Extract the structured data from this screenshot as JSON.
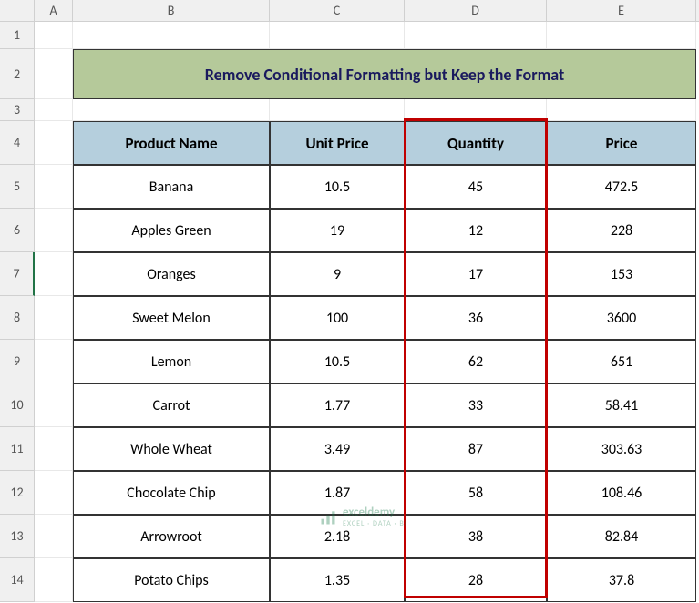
{
  "columns": [
    "A",
    "B",
    "C",
    "D",
    "E"
  ],
  "row_numbers": [
    1,
    2,
    3,
    4,
    5,
    6,
    7,
    8,
    9,
    10,
    11,
    12,
    13,
    14
  ],
  "title": "Remove Conditional Formatting but Keep the Format",
  "headers": {
    "product": "Product Name",
    "unit_price": "Unit Price",
    "quantity": "Quantity",
    "price": "Price"
  },
  "rows": [
    {
      "product": "Banana",
      "unit_price": "10.5",
      "quantity": "45",
      "price": "472.5"
    },
    {
      "product": "Apples Green",
      "unit_price": "19",
      "quantity": "12",
      "price": "228"
    },
    {
      "product": "Oranges",
      "unit_price": "9",
      "quantity": "17",
      "price": "153"
    },
    {
      "product": "Sweet Melon",
      "unit_price": "100",
      "quantity": "36",
      "price": "3600"
    },
    {
      "product": "Lemon",
      "unit_price": "10.5",
      "quantity": "62",
      "price": "651"
    },
    {
      "product": "Carrot",
      "unit_price": "1.77",
      "quantity": "33",
      "price": "58.41"
    },
    {
      "product": "Whole Wheat",
      "unit_price": "3.49",
      "quantity": "87",
      "price": "303.63"
    },
    {
      "product": "Chocolate Chip",
      "unit_price": "1.87",
      "quantity": "58",
      "price": "108.46"
    },
    {
      "product": "Arrowroot",
      "unit_price": "2.18",
      "quantity": "38",
      "price": "82.84"
    },
    {
      "product": "Potato Chips",
      "unit_price": "1.35",
      "quantity": "28",
      "price": "37.8"
    }
  ],
  "selected_row": 7,
  "watermark_text": "exceldemy",
  "watermark_sub": "EXCEL · DATA · BI",
  "chart_data": {
    "type": "table",
    "title": "Remove Conditional Formatting but Keep the Format",
    "columns": [
      "Product Name",
      "Unit Price",
      "Quantity",
      "Price"
    ],
    "data": [
      [
        "Banana",
        10.5,
        45,
        472.5
      ],
      [
        "Apples Green",
        19,
        12,
        228
      ],
      [
        "Oranges",
        9,
        17,
        153
      ],
      [
        "Sweet Melon",
        100,
        36,
        3600
      ],
      [
        "Lemon",
        10.5,
        62,
        651
      ],
      [
        "Carrot",
        1.77,
        33,
        58.41
      ],
      [
        "Whole Wheat",
        3.49,
        87,
        303.63
      ],
      [
        "Chocolate Chip",
        1.87,
        58,
        108.46
      ],
      [
        "Arrowroot",
        2.18,
        38,
        82.84
      ],
      [
        "Potato Chips",
        1.35,
        28,
        37.8
      ]
    ],
    "highlighted_column": "Quantity"
  }
}
